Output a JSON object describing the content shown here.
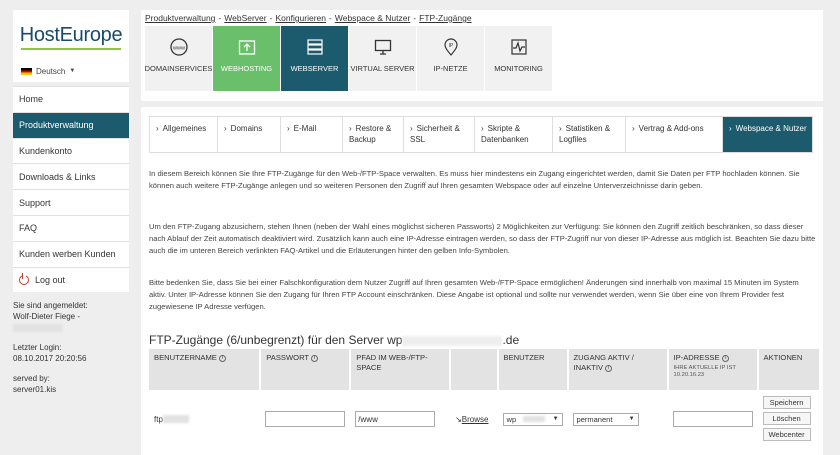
{
  "brand": {
    "name": "HostEurope"
  },
  "language": {
    "label": "Deutsch"
  },
  "sidebar": {
    "items": [
      {
        "label": "Home"
      },
      {
        "label": "Produktverwaltung"
      },
      {
        "label": "Kundenkonto"
      },
      {
        "label": "Downloads & Links"
      },
      {
        "label": "Support"
      },
      {
        "label": "FAQ"
      },
      {
        "label": "Kunden werben Kunden"
      },
      {
        "label": "Log out"
      }
    ],
    "logged_in_label": "Sie sind angemeldet:",
    "user_name": "Wolf-Dieter Fiege -",
    "last_login_label": "Letzter Login:",
    "last_login_value": "08.10.2017 20:20:56",
    "served_by_label": "served by:",
    "served_by_value": "server01.kis"
  },
  "breadcrumb": {
    "items": [
      "Produktverwaltung",
      "WebServer",
      "Konfigurieren",
      "Webspace & Nutzer",
      "FTP-Zugänge"
    ],
    "separator": "-"
  },
  "tiles": [
    {
      "label": "DOMAINSERVICES",
      "icon": "www-icon"
    },
    {
      "label": "WEBHOSTING",
      "icon": "upload-icon"
    },
    {
      "label": "WEBSERVER",
      "icon": "server-icon"
    },
    {
      "label": "VIRTUAL SERVER",
      "icon": "monitor-icon"
    },
    {
      "label": "IP-NETZE",
      "icon": "ip-pin-icon"
    },
    {
      "label": "MONITORING",
      "icon": "pulse-icon"
    }
  ],
  "tabs": [
    {
      "label": "Allgemeines"
    },
    {
      "label": "Domains"
    },
    {
      "label": "E-Mail"
    },
    {
      "label": "Restore & Backup"
    },
    {
      "label": "Sicherheit & SSL"
    },
    {
      "label": "Skripte & Datenbanken"
    },
    {
      "label": "Statistiken & Logfiles"
    },
    {
      "label": "Vertrag & Add-ons"
    },
    {
      "label": "Webspace & Nutzer"
    }
  ],
  "paragraphs": [
    "In diesem Bereich können Sie Ihre FTP-Zugänge für den Web-/FTP-Space verwalten. Es muss hier mindestens ein Zugang eingerichtet werden, damit Sie Daten per FTP hochladen können. Sie können auch weitere FTP-Zugänge anlegen und so weiteren Personen den Zugriff auf Ihren gesamten Webspace oder auf einzelne Unterverzeichnisse darin geben.",
    "Um den FTP-Zugang abzusichern, stehen Ihnen (neben der Wahl eines möglichst sicheren Passworts) 2 Möglichkeiten zur Verfügung: Sie können den Zugriff zeitlich beschränken, so dass dieser nach Ablauf der Zeit automatisch deaktiviert wird. Zusätzlich kann auch eine IP-Adresse eintragen werden, so dass der FTP-Zugriff nur von dieser IP-Adresse aus möglich ist. Beachten Sie dazu bitte auch die im unteren Bereich verlinkten FAQ-Artikel und die Erläuterungen hinter den gelben Info-Symbolen.",
    "Bitte bedenken Sie, dass Sie bei einer Falschkonfiguration dem Nutzer Zugriff auf Ihren gesamten Web-/FTP-Space ermöglichen! Änderungen sind innerhalb von maximal 15 Minuten im System aktiv. Unter IP-Adresse können Sie den Zugang für Ihren FTP Account einschränken. Diese Angabe ist optional und sollte nur verwendet werden, wenn Sie über eine von Ihrem Provider fest zugewiesene IP Adresse verfügen."
  ],
  "ftp_section": {
    "heading_prefix": "FTP-Zugänge (6/unbegrenzt) für den Server wp",
    "heading_suffix": ".de",
    "columns": [
      "BENUTZERNAME",
      "PASSWORT",
      "PFAD IM WEB-/FTP-SPACE",
      "",
      "BENUTZER",
      "ZUGANG AKTIV / INAKTIV",
      "IP-ADRESSE",
      "AKTIONEN"
    ],
    "ip_hint": "IHRE AKTUELLE IP IST 10.20.16.23",
    "row": {
      "username_prefix": "ftp",
      "password": "",
      "path": "/www",
      "browse_label": "Browse",
      "user_select": "wp",
      "status_select": "permanent",
      "ip": "",
      "actions": [
        "Speichern",
        "Löschen",
        "Webcenter"
      ]
    }
  },
  "colors": {
    "teal": "#1c5a6e",
    "green": "#6abf6a",
    "accent_green": "#8dc63f"
  }
}
